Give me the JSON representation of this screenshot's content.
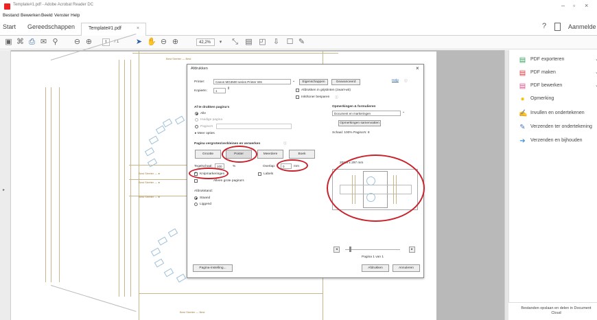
{
  "window": {
    "title": "Template#1.pdf - Adobe Acrobat Reader DC",
    "controls": [
      "–",
      "▫",
      "×"
    ]
  },
  "menu": [
    "Bestand",
    "Bewerken",
    "Beeld",
    "Venster",
    "Help"
  ],
  "tabs": {
    "home": "Start",
    "tools": "Gereedschappen",
    "document": "Template#1.pdf",
    "document_close": "×",
    "signin": "Aanmelde"
  },
  "toolbar": {
    "page_current": "1",
    "page_total": "/ 1",
    "zoom": "42,2%"
  },
  "page_labels": {
    "top": "Best Stretter — Best",
    "left1": "Best Stretter — ●",
    "left2": "Best Stretter — ●",
    "left3": "Best Stretter — ●",
    "bottom": "Best Stretter — Best"
  },
  "right_panel": {
    "tools": [
      {
        "label": "PDF exporteren",
        "icon": "export-pdf-icon",
        "color": "#2f9e5b",
        "chevron": true
      },
      {
        "label": "PDF maken",
        "icon": "create-pdf-icon",
        "color": "#d9323a",
        "chevron": true
      },
      {
        "label": "PDF bewerken",
        "icon": "edit-pdf-icon",
        "color": "#d64f8a",
        "chevron": true
      },
      {
        "label": "Opmerking",
        "icon": "comment-icon",
        "color": "#f2c318",
        "chevron": false
      },
      {
        "label": "Invullen en ondertekenen",
        "icon": "fill-sign-icon",
        "color": "#7a4fc1",
        "chevron": false
      },
      {
        "label": "Verzenden ter ondertekening",
        "icon": "send-sign-icon",
        "color": "#4e74c2",
        "chevron": false
      },
      {
        "label": "Verzenden en bijhouden",
        "icon": "send-track-icon",
        "color": "#3f8fd6",
        "chevron": false
      }
    ],
    "footer": "Bestanden opslaan en delen in Document Cloud"
  },
  "dialog": {
    "title": "Afdrukken",
    "close": "×",
    "help": "Help",
    "printer_label": "Printer:",
    "printer_value": "Canon MG3500 series Printer WS",
    "properties_button": "Eigenschappen",
    "advanced_button": "Geavanceerd",
    "copies_label": "Kopieën:",
    "copies_value": "1",
    "grayscale_label": "Afdrukken in grijstinten (zwart-wit)",
    "ink_label": "Inkt/toner besparen",
    "pages_heading": "Af te drukken pagina's",
    "pages_all": "Alle",
    "pages_current": "Huidige pagina",
    "pages_range": "Pagina's",
    "more_options": "▸ Meer opties",
    "comments_heading": "Opmerkingen & formulieren",
    "comments_value": "Document en markeringen",
    "summarize_button": "Opmerkingen samenvatten",
    "scale_text": "Schaal: 100% Pagina's: 8",
    "size_heading": "Pagina vergroten/verkleinen en verwerken",
    "mode_size": "Grootte",
    "mode_poster": "Poster",
    "mode_multiple": "Meerdere",
    "mode_booklet": "Boek",
    "tile_scale_label": "Tegelschaal:",
    "tile_scale_value": "100",
    "tile_scale_unit": "%",
    "overlap_label": "Overlap:",
    "overlap_value": "0",
    "overlap_unit": "mm",
    "cut_marks_label": "Knipmarkeringen",
    "labels_label": "Labels",
    "large_pages_label": "Alleen grote pagina's",
    "orientation_heading": "Afdrukstand:",
    "orientation_portrait": "Staand",
    "orientation_landscape": "Liggend",
    "preview_size": "209,9 x 297 mm",
    "preview_page": "Pagina 1 van 1",
    "page_setup_button": "Pagina-instelling...",
    "print_button": "Afdrukken",
    "cancel_button": "Annuleren"
  },
  "colors": {
    "annotation_red": "#c8232c",
    "page_line_tan": "#c8b68a",
    "rosette_blue": "#9fc1d8"
  }
}
